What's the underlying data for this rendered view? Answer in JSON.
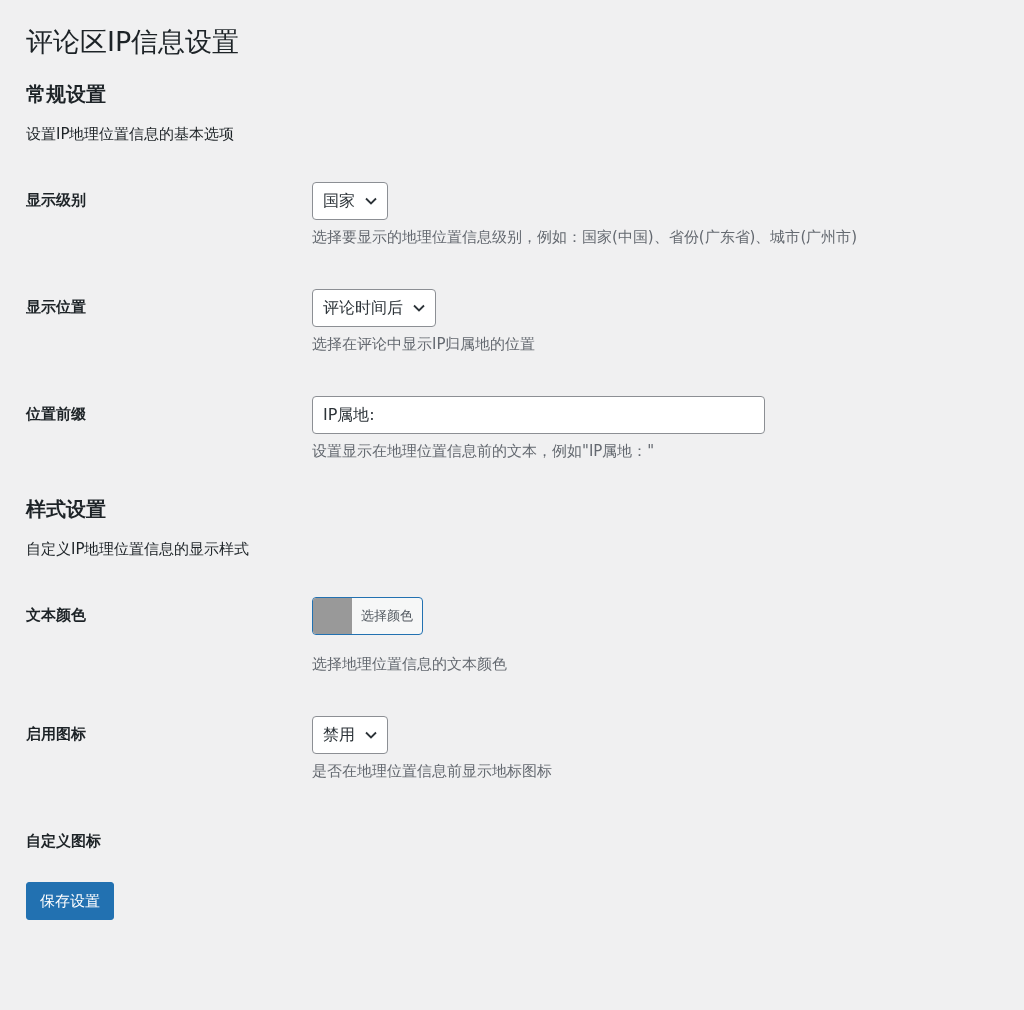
{
  "title": "评论区IP信息设置",
  "sections": [
    {
      "heading": "常规设置",
      "description": "设置IP地理位置信息的基本选项",
      "fields": [
        {
          "kind": "select",
          "label": "显示级别",
          "value": "国家",
          "help": "选择要显示的地理位置信息级别，例如：国家(中国)、省份(广东省)、城市(广州市)"
        },
        {
          "kind": "select",
          "label": "显示位置",
          "value": "评论时间后",
          "help": "选择在评论中显示IP归属地的位置"
        },
        {
          "kind": "text",
          "label": "位置前缀",
          "value": "IP属地:",
          "help": "设置显示在地理位置信息前的文本，例如\"IP属地：\""
        }
      ]
    },
    {
      "heading": "样式设置",
      "description": "自定义IP地理位置信息的显示样式",
      "fields": [
        {
          "kind": "color",
          "label": "文本颜色",
          "color": "#999999",
          "button_label": "选择颜色",
          "help": "选择地理位置信息的文本颜色"
        },
        {
          "kind": "select",
          "label": "启用图标",
          "value": "禁用",
          "help": "是否在地理位置信息前显示地标图标"
        },
        {
          "kind": "empty",
          "label": "自定义图标"
        }
      ]
    }
  ],
  "save_button": "保存设置"
}
